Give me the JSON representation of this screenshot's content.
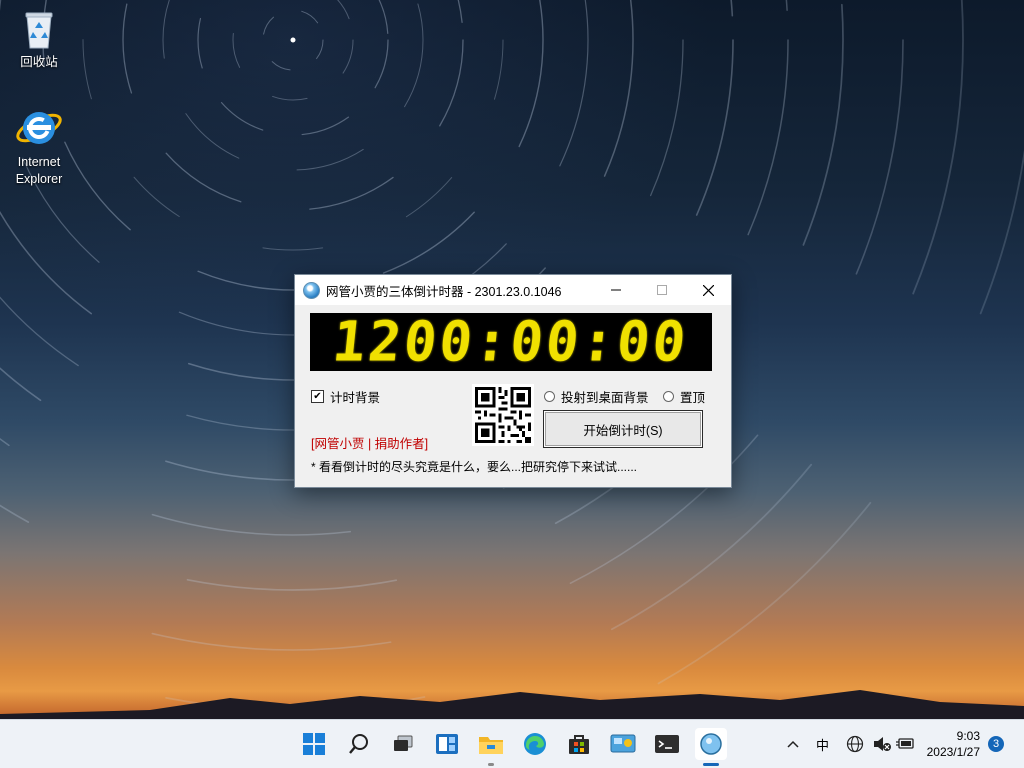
{
  "desktop": {
    "icons": [
      {
        "label": "回收站"
      },
      {
        "label": "Internet\nExplorer"
      }
    ]
  },
  "window": {
    "title": "网管小贾的三体倒计时器 - 2301.23.0.1046",
    "countdown": "1200:00:00",
    "checkbox_label": "计时背景",
    "checkbox_checked": true,
    "donate_link": "[网管小贾 | 捐助作者]",
    "radio_desktop_label": "投射到桌面背景",
    "radio_topmost_label": "置顶",
    "start_button_label": "开始倒计时(S)",
    "note": "* 看看倒计时的尽头究竟是什么，要么...把研究停下来试试......"
  },
  "taskbar": {
    "ime": "中",
    "time": "9:03",
    "date": "2023/1/27",
    "notification_count": "3"
  },
  "colors": {
    "digit": "#f0e000",
    "donate": "#c00000",
    "accent": "#1466b8"
  }
}
